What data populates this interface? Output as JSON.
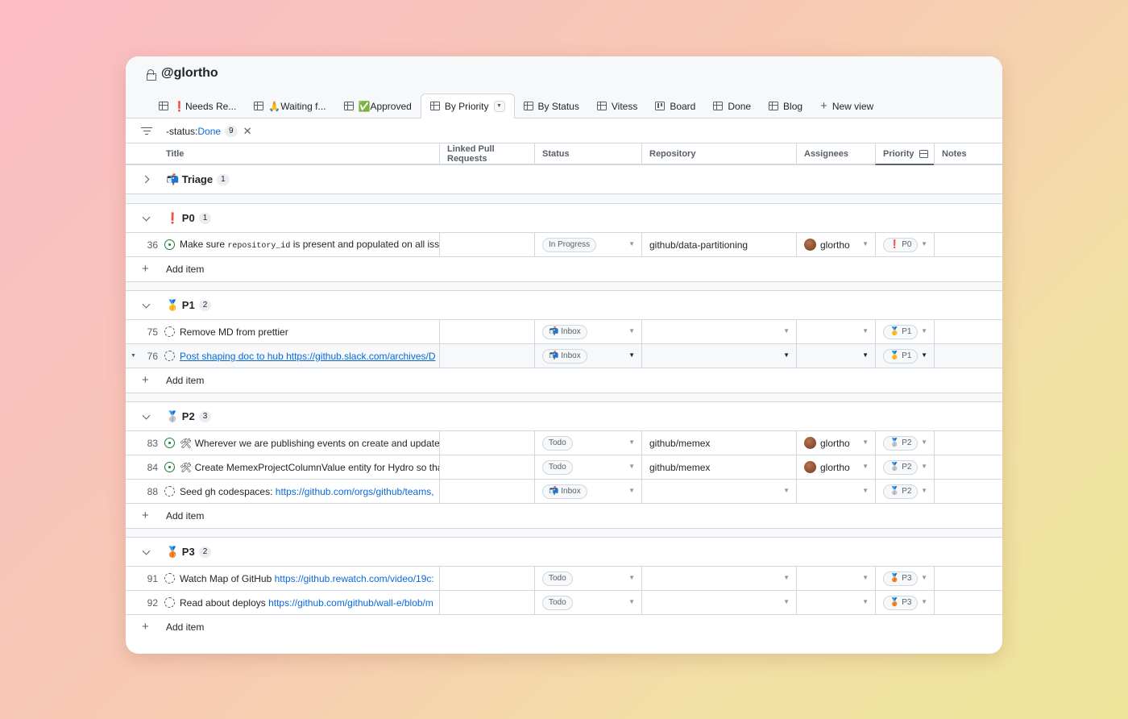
{
  "project": {
    "title": "@glortho"
  },
  "tabs": [
    {
      "label": "❗Needs Re...",
      "icon": "table-icon"
    },
    {
      "label": "🙏Waiting f...",
      "icon": "table-icon"
    },
    {
      "label": "✅Approved",
      "icon": "table-icon"
    },
    {
      "label": "By Priority",
      "icon": "table-icon",
      "active": true
    },
    {
      "label": "By Status",
      "icon": "table-icon"
    },
    {
      "label": "Vitess",
      "icon": "table-icon"
    },
    {
      "label": "Board",
      "icon": "board-icon"
    },
    {
      "label": "Done",
      "icon": "table-icon"
    },
    {
      "label": "Blog",
      "icon": "table-icon"
    },
    {
      "label": "New view",
      "icon": "plus-icon"
    }
  ],
  "filter": {
    "prefix": "-status:",
    "value": "Done",
    "count": "9"
  },
  "columns": [
    "Title",
    "Linked Pull Requests",
    "Status",
    "Repository",
    "Assignees",
    "Priority",
    "Notes"
  ],
  "groups": {
    "triage": {
      "label": "📬 Triage",
      "count": "1"
    },
    "p0": {
      "label": "❗ P0",
      "count": "1"
    },
    "p1": {
      "label": "🥇 P1",
      "count": "2"
    },
    "p2": {
      "label": "🥈 P2",
      "count": "3"
    },
    "p3": {
      "label": "🥉 P3",
      "count": "2"
    }
  },
  "add_item": "Add item",
  "rows": {
    "r36": {
      "num": "36",
      "pre": "Make sure ",
      "code": "repository_id",
      "post": " is present and populated on all issue",
      "status": "In Progress",
      "repo": "github/data-partitioning",
      "assignee": "glortho",
      "priority": "❗ P0"
    },
    "r75": {
      "num": "75",
      "title": "Remove MD from prettier",
      "status": "📬 Inbox",
      "priority": "🥇 P1"
    },
    "r76": {
      "num": "76",
      "title": "Post shaping doc to hub https://github.slack.com/archives/D",
      "status": "📬 Inbox",
      "priority": "🥇 P1"
    },
    "r83": {
      "num": "83",
      "title": "🛠 Wherever we are publishing events on create and update,",
      "status": "Todo",
      "repo": "github/memex",
      "assignee": "glortho",
      "priority": "🥈 P2"
    },
    "r84": {
      "num": "84",
      "title": "🛠 Create MemexProjectColumnValue entity for Hydro so that",
      "status": "Todo",
      "repo": "github/memex",
      "assignee": "glortho",
      "priority": "🥈 P2"
    },
    "r88": {
      "num": "88",
      "pre": "Seed gh codespaces: ",
      "link": "https://github.com/orgs/github/teams,",
      "status": "📬 Inbox",
      "priority": "🥈 P2"
    },
    "r91": {
      "num": "91",
      "pre": "Watch Map of GitHub ",
      "link": "https://github.rewatch.com/video/19c:",
      "status": "Todo",
      "priority": "🥉 P3"
    },
    "r92": {
      "num": "92",
      "pre": "Read about deploys ",
      "link": "https://github.com/github/wall-e/blob/m",
      "status": "Todo",
      "priority": "🥉 P3"
    }
  },
  "colors": {
    "accent": "#0969da",
    "open": "#1a7f37",
    "border": "#d0d7de"
  }
}
